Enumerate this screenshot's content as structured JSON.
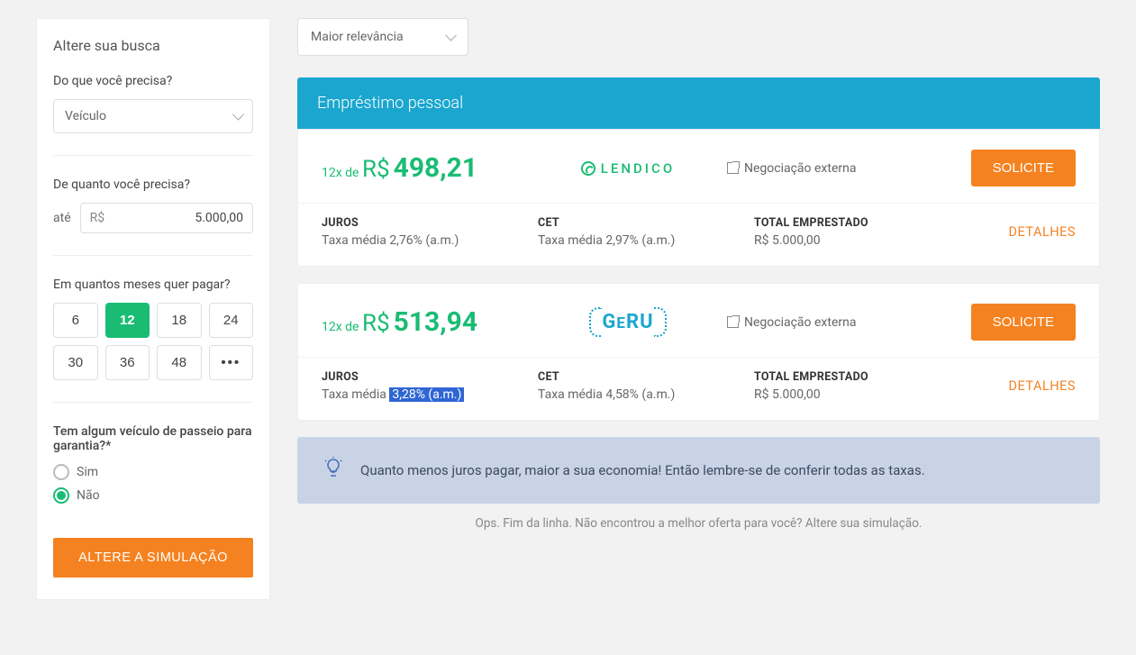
{
  "sidebar": {
    "title": "Altere sua busca",
    "need_label": "Do que você precisa?",
    "need_value": "Veículo",
    "amount_label": "De quanto você precisa?",
    "amount_prefix": "até",
    "amount_currency": "R$",
    "amount_value": "5.000,00",
    "months_label": "Em quantos meses quer pagar?",
    "months_options": [
      "6",
      "12",
      "18",
      "24",
      "30",
      "36",
      "48",
      "•••"
    ],
    "months_selected": "12",
    "guarantee_label": "Tem algum veículo de passeio para garantia?*",
    "guarantee_yes": "Sim",
    "guarantee_no": "Não",
    "guarantee_selected": "Não",
    "submit": "ALTERE A SIMULAÇÃO"
  },
  "sort_label": "Maior relevância",
  "section_title": "Empréstimo pessoal",
  "negociacao": "Negociação externa",
  "solicite": "SOLICITE",
  "detalhes": "DETALHES",
  "labels": {
    "juros": "JUROS",
    "cet": "CET",
    "total": "TOTAL EMPRESTADO"
  },
  "offers": [
    {
      "inst_prefix": "12x de",
      "price": "498,21",
      "currency": "R$",
      "lender": "LENDICO",
      "juros": "Taxa média 2,76% (a.m.)",
      "cet": "Taxa média 2,97% (a.m.)",
      "total": "R$ 5.000,00"
    },
    {
      "inst_prefix": "12x de",
      "price": "513,94",
      "currency": "R$",
      "lender": "GERU",
      "juros_prefix": "Taxa média ",
      "juros_hl": "3,28% (a.m.)",
      "cet": "Taxa média 4,58% (a.m.)",
      "total": "R$ 5.000,00"
    }
  ],
  "tip": "Quanto menos juros pagar, maior a sua economia! Então lembre-se de conferir todas as taxas.",
  "end": "Ops. Fim da linha. Não encontrou a melhor oferta para você? Altere sua simulação."
}
